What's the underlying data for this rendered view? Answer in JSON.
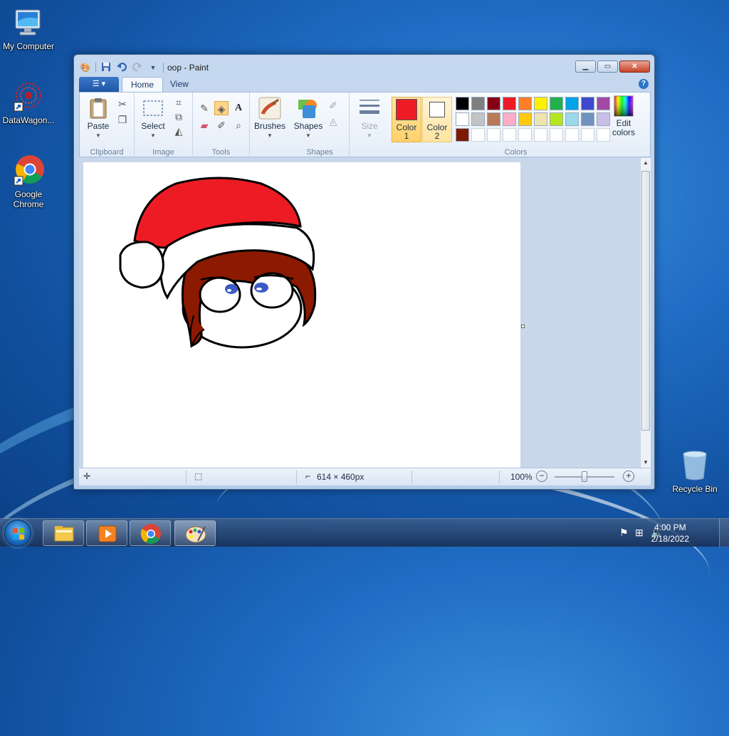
{
  "desktop": {
    "icons": [
      {
        "label": "My Computer",
        "icon": "computer-icon"
      },
      {
        "label": "DataWagon...",
        "icon": "datawagon-icon"
      },
      {
        "label": "Google Chrome",
        "icon": "chrome-icon"
      },
      {
        "label": "Recycle Bin",
        "icon": "recycle-bin-icon"
      }
    ]
  },
  "window": {
    "title": "oop - Paint",
    "menu": {
      "home_tab": "Home",
      "view_tab": "View"
    }
  },
  "ribbon": {
    "clipboard": {
      "paste_label": "Paste",
      "group_label": "Clipboard"
    },
    "image": {
      "select_label": "Select",
      "group_label": "Image"
    },
    "tools": {
      "group_label": "Tools"
    },
    "brushes": {
      "label": "Brushes"
    },
    "shapes": {
      "label": "Shapes",
      "group_label": "Shapes"
    },
    "size": {
      "label": "Size"
    },
    "colors": {
      "color1_line1": "Color",
      "color1_line2": "1",
      "color2_line1": "Color",
      "color2_line2": "2",
      "color1_value": "#ed1c24",
      "color2_value": "#ffffff",
      "edit_line1": "Edit",
      "edit_line2": "colors",
      "group_label": "Colors",
      "palette_row1": [
        "#000000",
        "#7f7f7f",
        "#880015",
        "#ed1c24",
        "#ff7f27",
        "#fff200",
        "#22b14c",
        "#00a2e8",
        "#3f48cc",
        "#a349a4"
      ],
      "palette_row2": [
        "#ffffff",
        "#c3c3c3",
        "#b97a57",
        "#ffaec9",
        "#ffc90e",
        "#efe4b0",
        "#b5e61d",
        "#99d9ea",
        "#7092be",
        "#c8bfe7"
      ],
      "palette_row3": [
        "#7f1a00"
      ]
    }
  },
  "statusbar": {
    "size": "614 × 460px",
    "zoom": "100%"
  },
  "taskbar": {
    "time": "4:00 PM",
    "date": "2/18/2022"
  }
}
